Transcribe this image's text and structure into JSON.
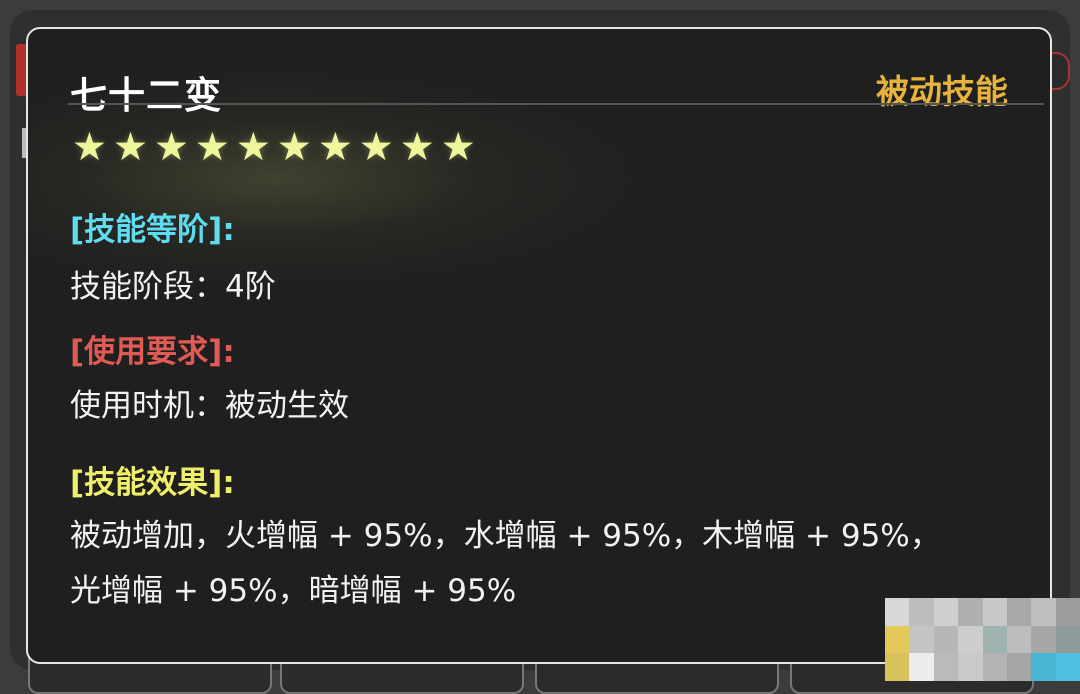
{
  "skill": {
    "name": "七十二变",
    "type_label": "被动技能",
    "star_count": 10,
    "star_glyph": "★",
    "sections": {
      "grade": {
        "header": "[技能等阶]:",
        "header_color": "#5fdcef",
        "line_label": "技能阶段：",
        "line_value": "4阶"
      },
      "requirement": {
        "header": "[使用要求]:",
        "header_color": "#e15b55",
        "line_label": "使用时机：",
        "line_value": "被动生效"
      },
      "effect": {
        "header": "[技能效果]:",
        "header_color": "#f0ef6a",
        "text": "被动增加，火增幅 + 95%，水增幅 + 95%，木增幅 + 95%，光增幅 + 95%，暗增幅 + 95%"
      }
    }
  },
  "colors": {
    "title": "#ffffff",
    "type_label": "#e6b43e",
    "star": "#eef59a",
    "card_bg": "#1f1f1f",
    "card_border": "#e6e6e6"
  }
}
